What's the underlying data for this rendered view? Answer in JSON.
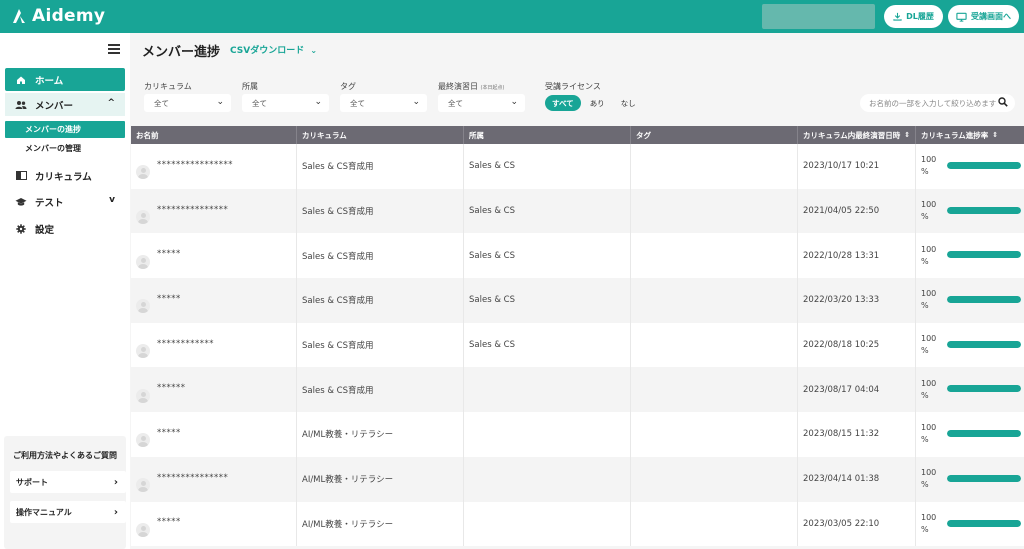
{
  "header": {
    "brand": "Aidemy",
    "dl_history": "DL履歴",
    "to_student_view": "受講画面へ"
  },
  "sidebar": {
    "home": "ホーム",
    "member": "メンバー",
    "member_progress": "メンバーの進捗",
    "member_manage": "メンバーの管理",
    "curriculum": "カリキュラム",
    "test": "テスト",
    "settings": "設定",
    "help_title": "ご利用方法やよくあるご質問",
    "support": "サポート",
    "manual": "操作マニュアル"
  },
  "page": {
    "title": "メンバー進捗",
    "csv_download": "CSVダウンロード"
  },
  "filters": {
    "curriculum_label": "カリキュラム",
    "curriculum_value": "全て",
    "dept_label": "所属",
    "dept_value": "全て",
    "tag_label": "タグ",
    "tag_value": "全て",
    "last_study_label": "最終演習日",
    "last_study_note": "(本日起点)",
    "last_study_value": "全て",
    "license_label": "受講ライセンス",
    "license_all": "すべて",
    "license_yes": "あり",
    "license_no": "なし",
    "search_placeholder": "お名前の一部を入力して絞り込めます"
  },
  "table": {
    "columns": [
      "お名前",
      "カリキュラム",
      "所属",
      "タグ",
      "カリキュラム内最終演習日時",
      "カリキュラム進捗率"
    ],
    "rows": [
      {
        "name": "****************",
        "curriculum": "Sales & CS育成用",
        "dept": "Sales & CS",
        "tag": "",
        "last": "2023/10/17 10:21",
        "progress": 100
      },
      {
        "name": "***************",
        "curriculum": "Sales & CS育成用",
        "dept": "Sales & CS",
        "tag": "",
        "last": "2021/04/05 22:50",
        "progress": 100
      },
      {
        "name": "*****",
        "curriculum": "Sales & CS育成用",
        "dept": "Sales & CS",
        "tag": "",
        "last": "2022/10/28 13:31",
        "progress": 100
      },
      {
        "name": "*****",
        "curriculum": "Sales & CS育成用",
        "dept": "Sales & CS",
        "tag": "",
        "last": "2022/03/20 13:33",
        "progress": 100
      },
      {
        "name": "************",
        "curriculum": "Sales & CS育成用",
        "dept": "Sales & CS",
        "tag": "",
        "last": "2022/08/18 10:25",
        "progress": 100
      },
      {
        "name": "******",
        "curriculum": "Sales & CS育成用",
        "dept": "",
        "tag": "",
        "last": "2023/08/17 04:04",
        "progress": 100
      },
      {
        "name": "*****",
        "curriculum": "AI/ML教養・リテラシー",
        "dept": "",
        "tag": "",
        "last": "2023/08/15 11:32",
        "progress": 100
      },
      {
        "name": "***************",
        "curriculum": "AI/ML教養・リテラシー",
        "dept": "",
        "tag": "",
        "last": "2023/04/14 01:38",
        "progress": 100
      },
      {
        "name": "*****",
        "curriculum": "AI/ML教養・リテラシー",
        "dept": "",
        "tag": "",
        "last": "2023/03/05 22:10",
        "progress": 100
      }
    ],
    "pct_unit": "%"
  },
  "colors": {
    "accent": "#18a596",
    "table_header": "#6c6a73"
  }
}
